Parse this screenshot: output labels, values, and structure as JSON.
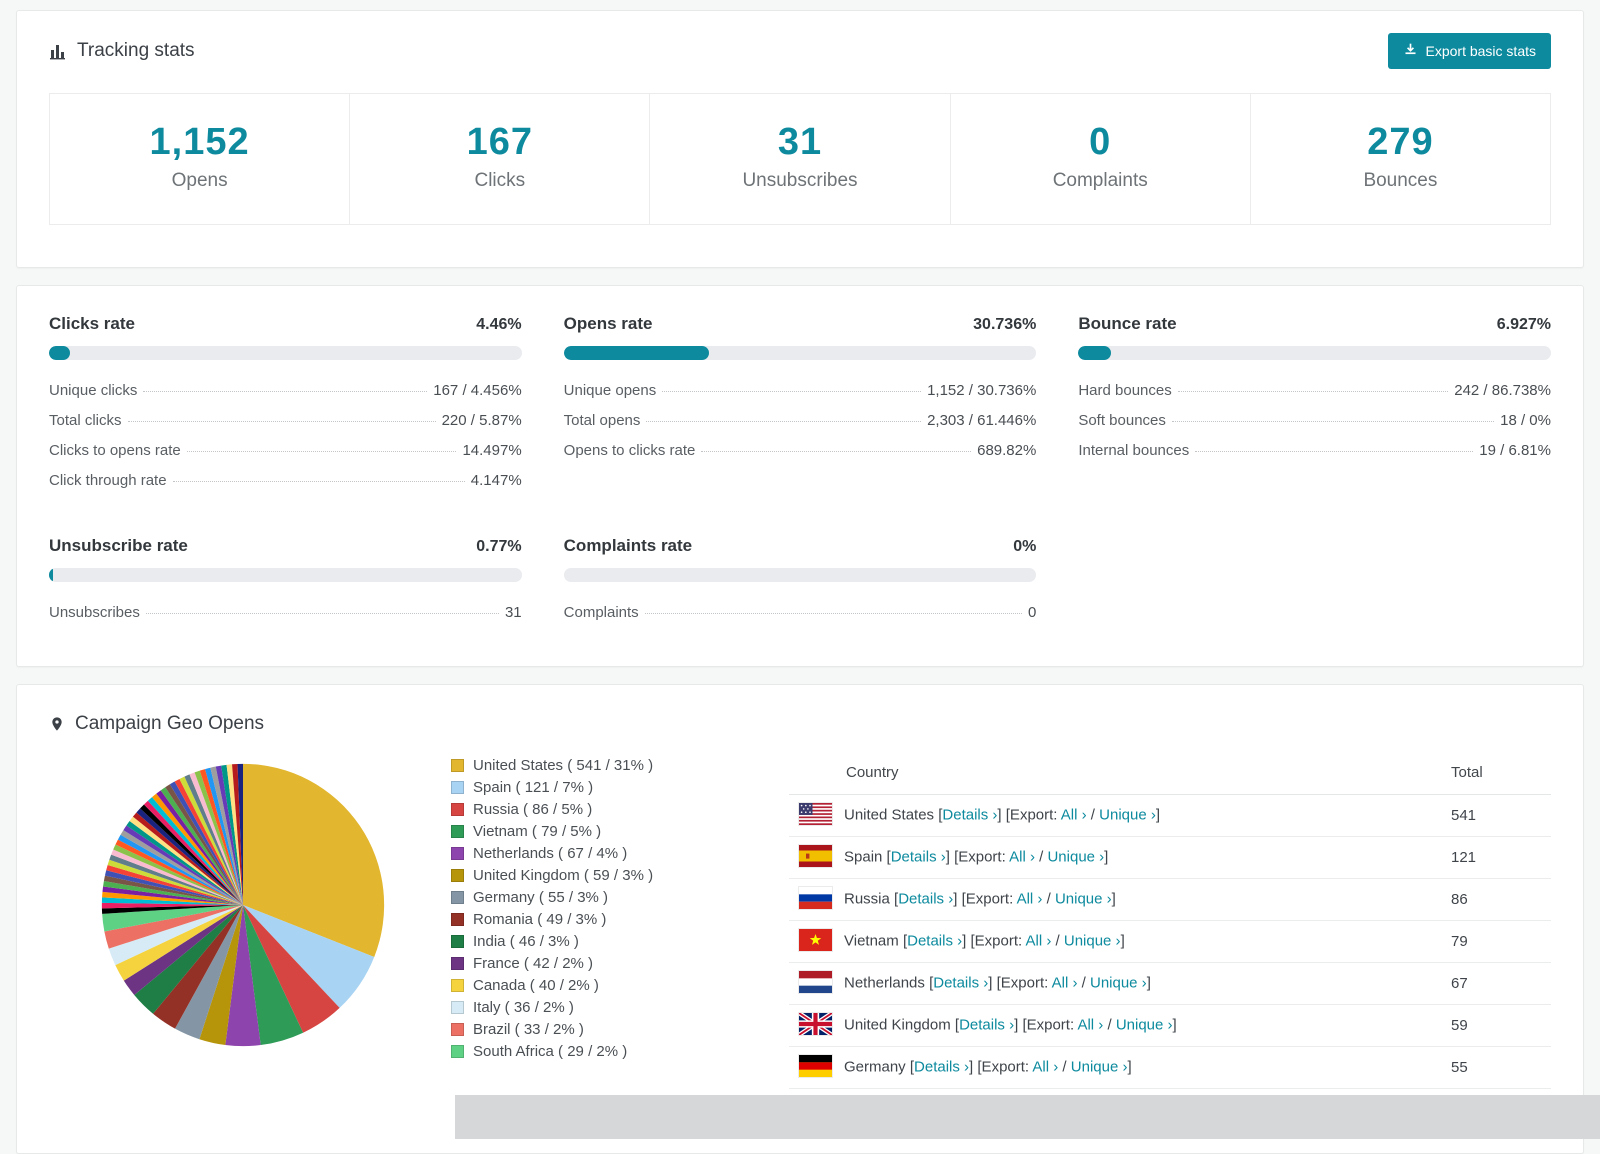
{
  "accent_color": "#0d8a9e",
  "tracking": {
    "title": "Tracking stats",
    "export_button": "Export basic stats",
    "stats": [
      {
        "value": "1,152",
        "label": "Opens"
      },
      {
        "value": "167",
        "label": "Clicks"
      },
      {
        "value": "31",
        "label": "Unsubscribes"
      },
      {
        "value": "0",
        "label": "Complaints"
      },
      {
        "value": "279",
        "label": "Bounces"
      }
    ]
  },
  "rates": {
    "panels": [
      {
        "title": "Clicks rate",
        "value": "4.46%",
        "percent": 4.46,
        "rows": [
          [
            "Unique clicks",
            "167 / 4.456%"
          ],
          [
            "Total clicks",
            "220 / 5.87%"
          ],
          [
            "Clicks to opens rate",
            "14.497%"
          ],
          [
            "Click through rate",
            "4.147%"
          ]
        ]
      },
      {
        "title": "Opens rate",
        "value": "30.736%",
        "percent": 30.736,
        "rows": [
          [
            "Unique opens",
            "1,152 / 30.736%"
          ],
          [
            "Total opens",
            "2,303 / 61.446%"
          ],
          [
            "Opens to clicks rate",
            "689.82%"
          ]
        ]
      },
      {
        "title": "Bounce rate",
        "value": "6.927%",
        "percent": 6.927,
        "rows": [
          [
            "Hard bounces",
            "242 / 86.738%"
          ],
          [
            "Soft bounces",
            "18 / 0%"
          ],
          [
            "Internal bounces",
            "19 / 6.81%"
          ]
        ]
      },
      {
        "title": "Unsubscribe rate",
        "value": "0.77%",
        "percent": 0.77,
        "rows": [
          [
            "Unsubscribes",
            "31"
          ]
        ]
      },
      {
        "title": "Complaints rate",
        "value": "0%",
        "percent": 0,
        "rows": [
          [
            "Complaints",
            "0"
          ]
        ]
      }
    ]
  },
  "geo": {
    "title": "Campaign Geo Opens",
    "table": {
      "headers": [
        "Country",
        "Total"
      ],
      "links": {
        "details": "Details",
        "export": "Export:",
        "all": "All",
        "unique": "Unique",
        "chevron": "›"
      },
      "rows": [
        {
          "country": "United States",
          "flag": "us",
          "total": "541"
        },
        {
          "country": "Spain",
          "flag": "es",
          "total": "121"
        },
        {
          "country": "Russia",
          "flag": "ru",
          "total": "86"
        },
        {
          "country": "Vietnam",
          "flag": "vn",
          "total": "79"
        },
        {
          "country": "Netherlands",
          "flag": "nl",
          "total": "67"
        },
        {
          "country": "United Kingdom",
          "flag": "gb",
          "total": "59"
        },
        {
          "country": "Germany",
          "flag": "de",
          "total": "55"
        }
      ]
    }
  },
  "chart_data": {
    "type": "pie",
    "title": "Campaign Geo Opens",
    "labels": [
      "United States",
      "Spain",
      "Russia",
      "Vietnam",
      "Netherlands",
      "United Kingdom",
      "Germany",
      "Romania",
      "India",
      "France",
      "Canada",
      "Italy",
      "Brazil",
      "South Africa"
    ],
    "values": [
      541,
      121,
      86,
      79,
      67,
      59,
      55,
      49,
      46,
      42,
      40,
      36,
      33,
      29
    ],
    "percents": [
      31,
      7,
      5,
      5,
      4,
      3,
      3,
      3,
      3,
      2,
      2,
      2,
      2,
      2
    ],
    "colors": [
      "#e2b62e",
      "#a8d3f2",
      "#d64541",
      "#2e9b57",
      "#8e44ad",
      "#b7950b",
      "#8496a5",
      "#943126",
      "#1e7e45",
      "#6c3483",
      "#f5d33f",
      "#d6ebf5",
      "#ec7063",
      "#5fd185"
    ],
    "others": {
      "percent": 26,
      "slice_count": 42,
      "palette": [
        "#000000",
        "#e91e63",
        "#00bcd4",
        "#ff9800",
        "#7b1fa2",
        "#4caf50",
        "#795548",
        "#3f51b5",
        "#f44336",
        "#cddc39",
        "#607d8b",
        "#f8bbd0",
        "#8bc34a",
        "#ff5722",
        "#2196f3",
        "#9e9e9e",
        "#673ab7",
        "#009688",
        "#ffe082",
        "#b71c1c",
        "#1a237e"
      ]
    },
    "legend_position": "right",
    "legend_format": "label ( value / percent% )"
  }
}
